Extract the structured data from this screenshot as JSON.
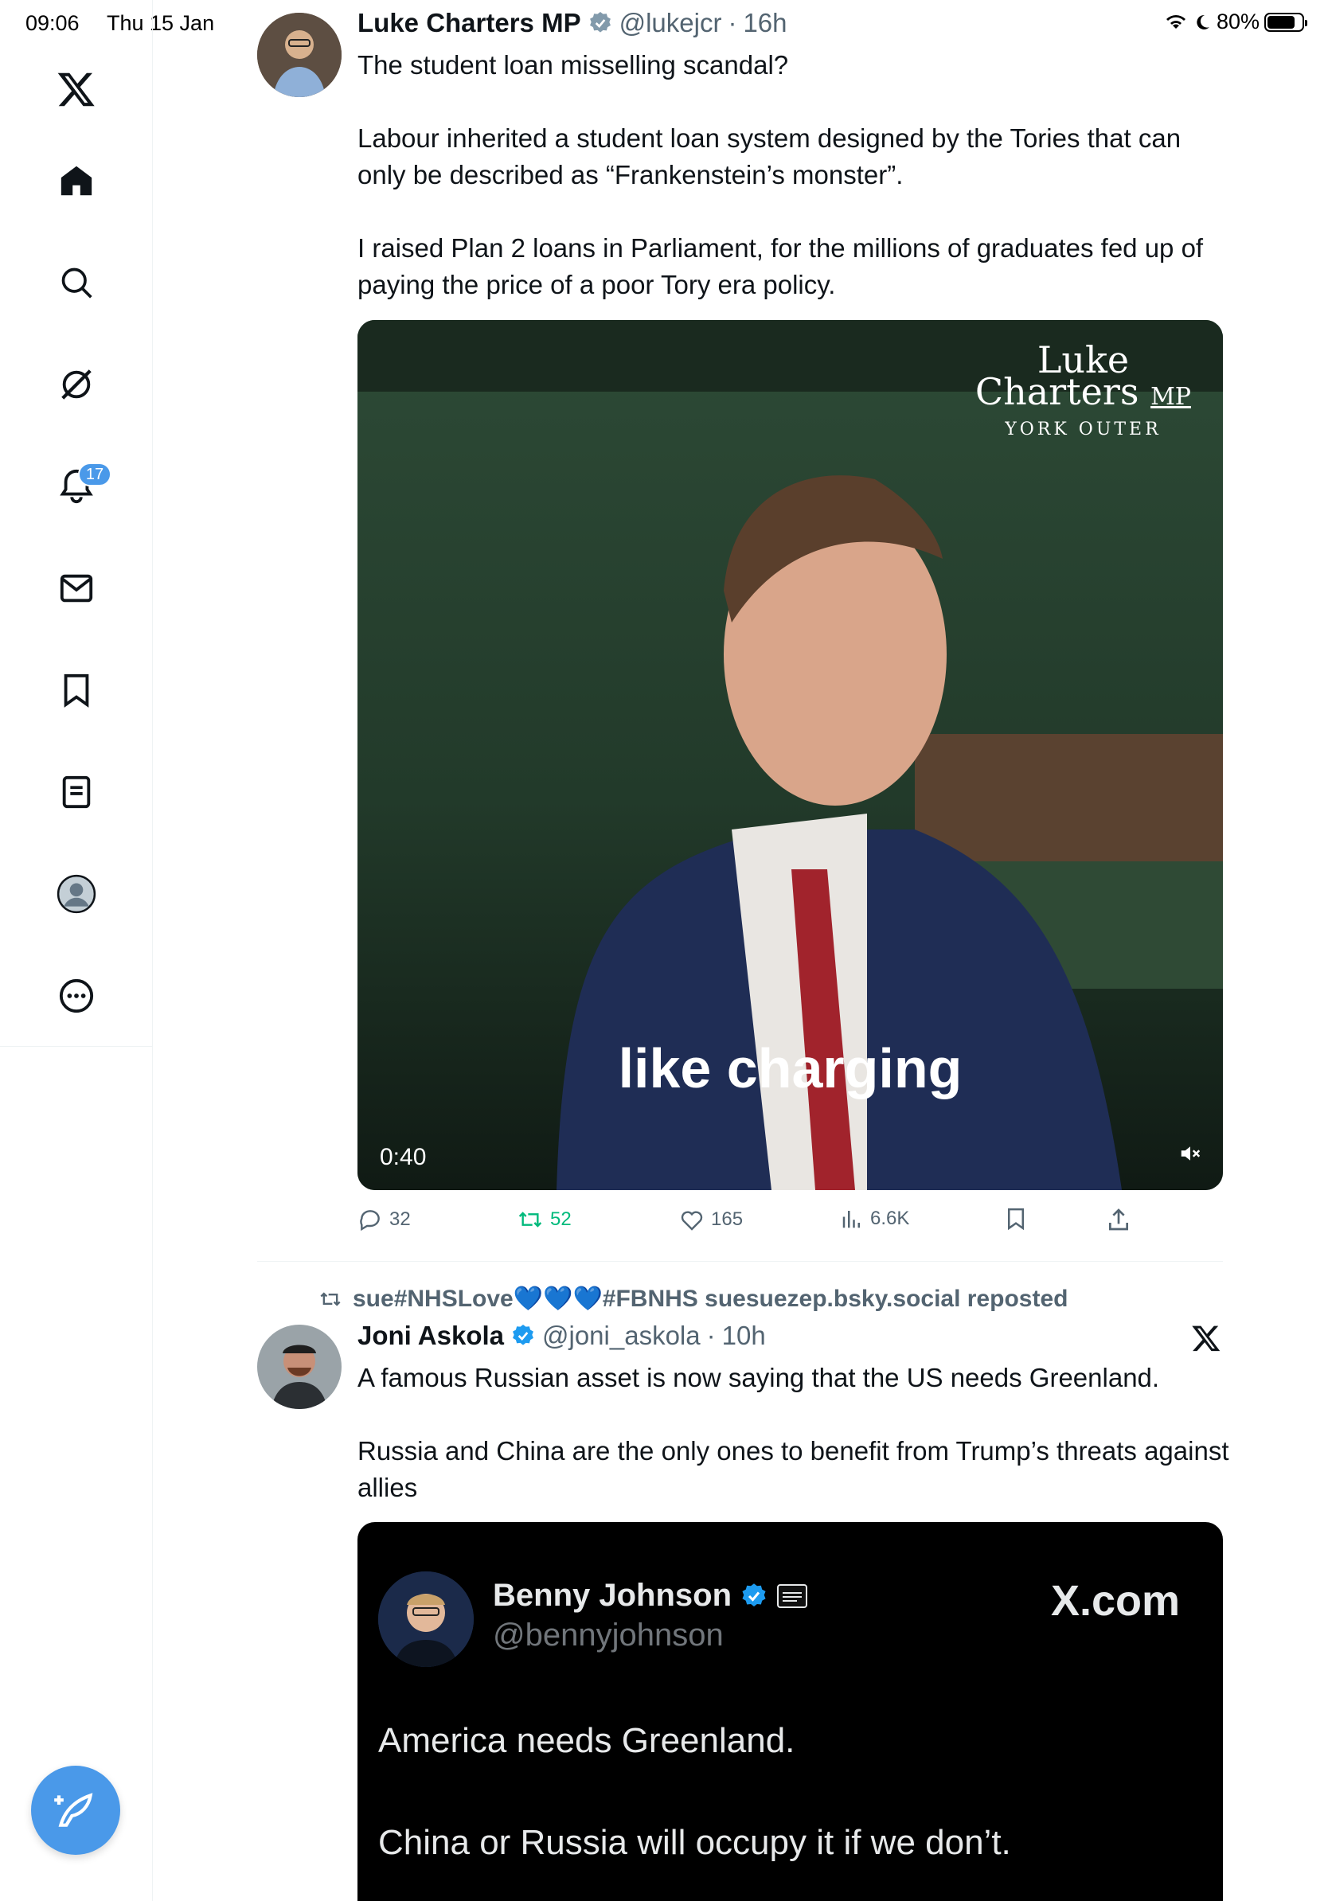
{
  "status_bar": {
    "time": "09:06",
    "date": "Thu 15 Jan",
    "battery": "80%"
  },
  "sidebar": {
    "notifications_badge": "17",
    "items": [
      {
        "name": "x-logo-icon"
      },
      {
        "name": "home-icon"
      },
      {
        "name": "search-icon"
      },
      {
        "name": "grok-icon"
      },
      {
        "name": "notifications-icon"
      },
      {
        "name": "messages-icon"
      },
      {
        "name": "bookmarks-icon"
      },
      {
        "name": "lists-icon"
      },
      {
        "name": "profile-icon"
      },
      {
        "name": "more-icon"
      }
    ]
  },
  "tweet1": {
    "name": "Luke Charters MP",
    "handle": "@lukejcr",
    "sep": "·",
    "time": "16h",
    "text": [
      "The student loan misselling scandal?",
      "Labour inherited a student loan system designed by the Tories that can only be described as “Frankenstein’s monster”.",
      "I raised Plan 2 loans in Parliament, for the millions of graduates fed up of paying the price of a poor Tory era policy."
    ],
    "video": {
      "brand_line1": "Luke",
      "brand_line2": "Charters",
      "brand_mp": "MP",
      "brand_line3": "YORK OUTER",
      "caption": "like charging",
      "duration": "0:40"
    },
    "actions": {
      "replies": "32",
      "reposts": "52",
      "likes": "165",
      "views": "6.6K"
    }
  },
  "tweet2": {
    "repost_by": "sue#NHSLove💙💙💙#FBNHS suesuezep.bsky.social reposted",
    "name": "Joni Askola",
    "handle": "@joni_askola",
    "sep": "·",
    "time": "10h",
    "text": [
      "A famous Russian asset is now saying that the US needs Greenland.",
      "Russia and China are the only ones to benefit from Trump’s threats against allies"
    ],
    "quote_image": {
      "name": "Benny Johnson",
      "handle": "@bennyjohnson",
      "brand": "X.com",
      "line1": "America needs Greenland.",
      "line2": "China or Russia will occupy it if we don’t."
    }
  }
}
